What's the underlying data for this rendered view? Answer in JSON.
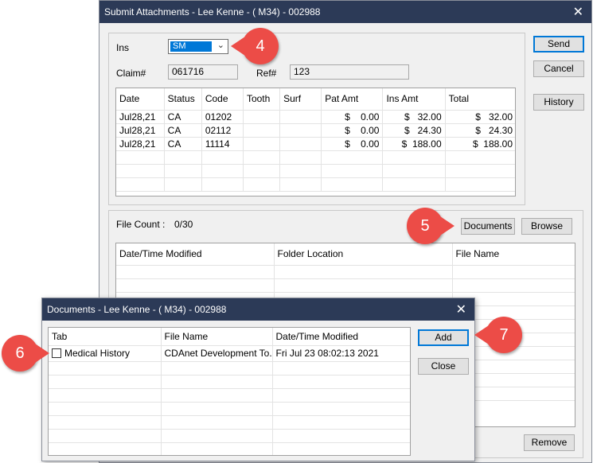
{
  "main_dialog": {
    "title": "Submit Attachments - Lee Kenne - ( M34) - 002988",
    "ins_label": "Ins",
    "ins_value": "SM",
    "claim_label": "Claim#",
    "claim_value": "061716",
    "ref_label": "Ref#",
    "ref_value": "123",
    "buttons": {
      "send": "Send",
      "cancel": "Cancel",
      "history": "History",
      "documents": "Documents",
      "browse": "Browse",
      "remove": "Remove"
    },
    "procedures": {
      "columns": [
        "Date",
        "Status",
        "Code",
        "Tooth",
        "Surf",
        "Pat Amt",
        "Ins Amt",
        "Total"
      ],
      "rows": [
        [
          "Jul28,21",
          "CA",
          "01202",
          "",
          "",
          "$    0.00",
          "$   32.00",
          "$   32.00"
        ],
        [
          "Jul28,21",
          "CA",
          "02112",
          "",
          "",
          "$    0.00",
          "$   24.30",
          "$   24.30"
        ],
        [
          "Jul28,21",
          "CA",
          "11114",
          "",
          "",
          "$    0.00",
          "$  188.00",
          "$  188.00"
        ]
      ]
    },
    "file_count_label": "File Count :",
    "file_count_value": "0/30",
    "files": {
      "columns": [
        "Date/Time Modified",
        "Folder Location",
        "File Name"
      ]
    }
  },
  "documents_dialog": {
    "title": "Documents - Lee Kenne - ( M34) - 002988",
    "columns": [
      "Tab",
      "File Name",
      "Date/Time Modified"
    ],
    "rows": [
      {
        "tab": "Medical History",
        "file_name": "CDAnet Development To...",
        "modified": "Fri Jul 23 08:02:13 2021"
      }
    ],
    "buttons": {
      "add": "Add",
      "close": "Close"
    }
  },
  "callouts": [
    "4",
    "5",
    "6",
    "7"
  ],
  "colors": {
    "titlebar": "#2c3a57",
    "callout": "#ec4c47",
    "selection": "#0078d7"
  }
}
